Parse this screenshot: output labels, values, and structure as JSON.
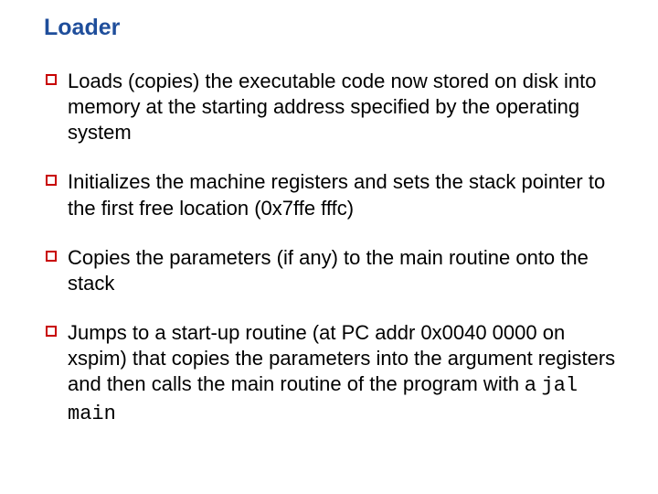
{
  "slide": {
    "title": "Loader",
    "items": [
      {
        "text": "Loads (copies) the executable code now stored on disk into memory at the starting address specified by the operating system"
      },
      {
        "text": "Initializes the machine registers and sets the stack pointer to the first free location (0x7ffe fffc)"
      },
      {
        "text": "Copies the parameters (if any) to the main routine onto the stack"
      },
      {
        "text": "Jumps to a start-up routine (at PC addr 0x0040 0000 on xspim) that copies the parameters into the argument registers and then calls the main routine of the program with a ",
        "code": "jal main"
      }
    ]
  }
}
